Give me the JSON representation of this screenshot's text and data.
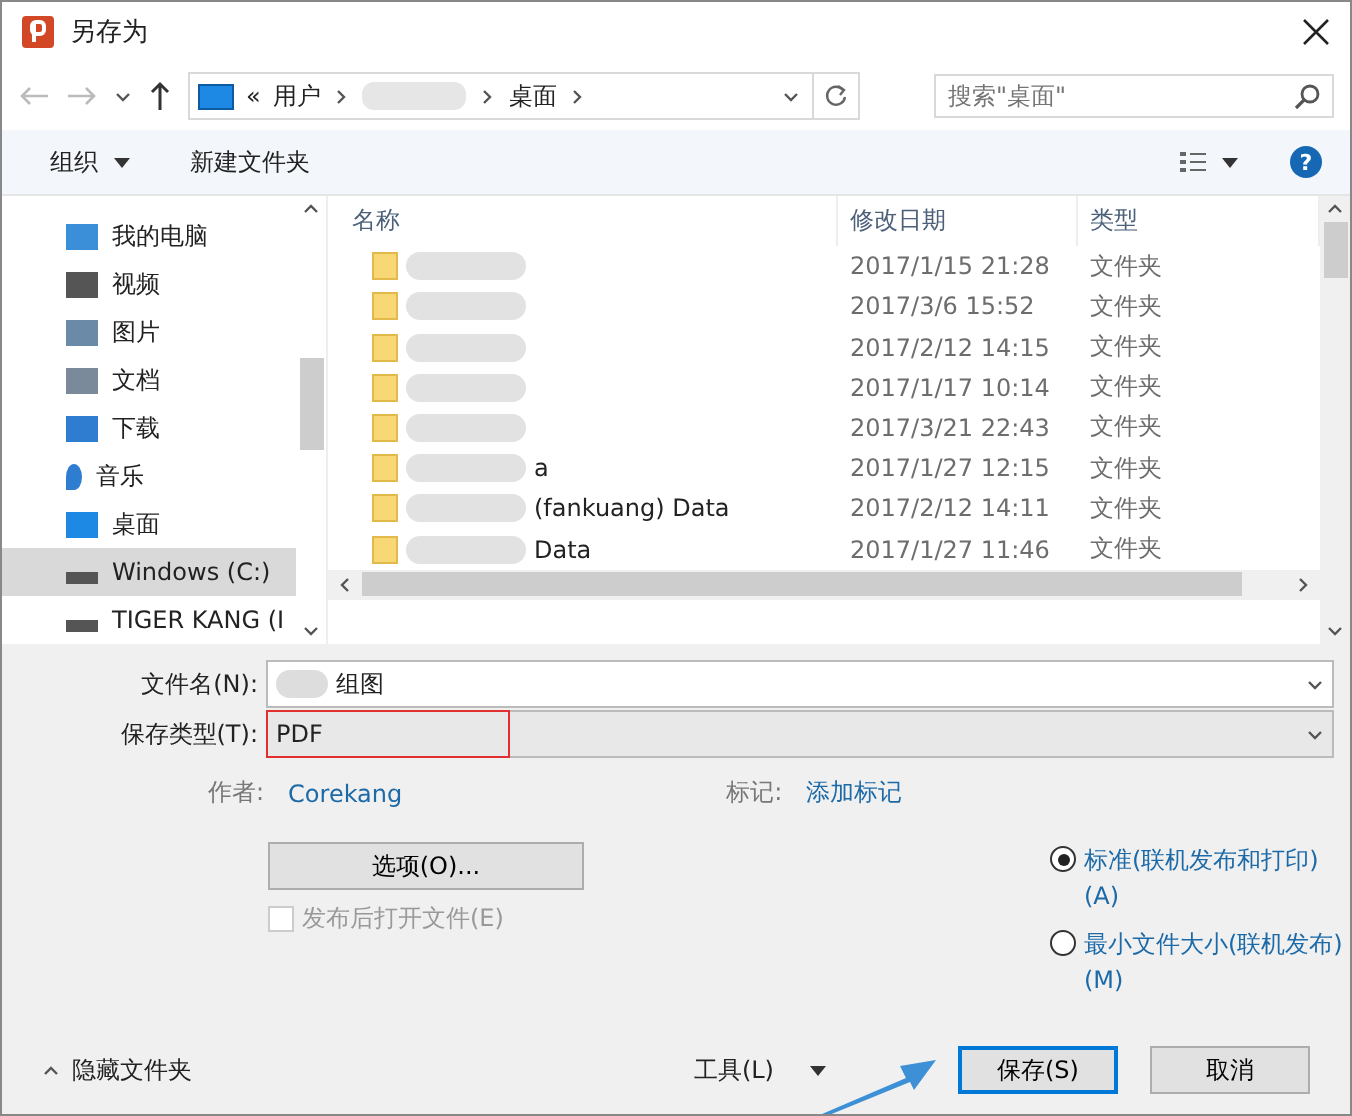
{
  "window": {
    "title": "另存为"
  },
  "address_bar": {
    "segments": [
      "«",
      "用户",
      "桌面"
    ]
  },
  "search": {
    "placeholder": "搜索\"桌面\""
  },
  "toolbar": {
    "organize": "组织",
    "new_folder": "新建文件夹",
    "help": "?"
  },
  "sidebar": {
    "items": [
      {
        "label": "我的电脑",
        "selected": false
      },
      {
        "label": "视频",
        "selected": false
      },
      {
        "label": "图片",
        "selected": false
      },
      {
        "label": "文档",
        "selected": false
      },
      {
        "label": "下载",
        "selected": false
      },
      {
        "label": "音乐",
        "selected": false
      },
      {
        "label": "桌面",
        "selected": false
      },
      {
        "label": "Windows (C:)",
        "selected": true
      },
      {
        "label": "TIGER KANG (I",
        "selected": false
      }
    ]
  },
  "table": {
    "columns": [
      "名称",
      "修改日期",
      "类型"
    ],
    "rows": [
      {
        "name": "",
        "date": "2017/1/15 21:28",
        "type": "文件夹"
      },
      {
        "name": "",
        "date": "2017/3/6 15:52",
        "type": "文件夹"
      },
      {
        "name": "",
        "date": "2017/2/12 14:15",
        "type": "文件夹"
      },
      {
        "name": "",
        "date": "2017/1/17 10:14",
        "type": "文件夹"
      },
      {
        "name": "",
        "date": "2017/3/21 22:43",
        "type": "文件夹"
      },
      {
        "name": "a",
        "date": "2017/1/27 12:15",
        "type": "文件夹"
      },
      {
        "name": "(fankuang) Data",
        "date": "2017/2/12 14:11",
        "type": "文件夹"
      },
      {
        "name": "Data",
        "date": "2017/1/27 11:46",
        "type": "文件夹"
      }
    ]
  },
  "form": {
    "filename_label": "文件名(N):",
    "filename": "组图",
    "type_label": "保存类型(T):",
    "type": "PDF",
    "author_label": "作者:",
    "author": "Corekang",
    "tags_label": "标记:",
    "tags": "添加标记",
    "options_button": "选项(O)...",
    "open_after": {
      "label": "发布后打开文件(E)",
      "checked": false,
      "disabled": true
    },
    "radios": [
      {
        "label": "标准(联机发布和打印)(A)",
        "selected": true
      },
      {
        "label": "最小文件大小(联机发布)(M)",
        "selected": false
      }
    ]
  },
  "footer": {
    "hide_folders": "隐藏文件夹",
    "tools": "工具(L)",
    "save": "保存(S)",
    "cancel": "取消"
  }
}
